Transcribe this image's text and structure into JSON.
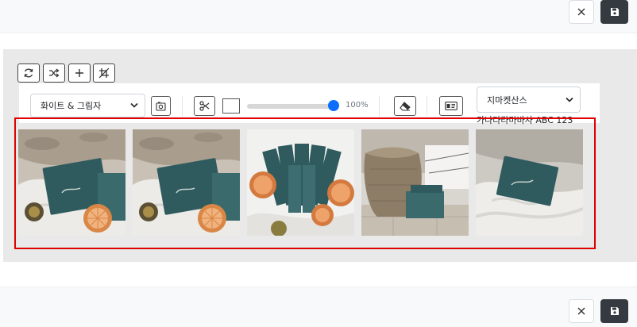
{
  "toolbar": {
    "background_select": {
      "value": "화이트 & 그림자"
    },
    "font_select": {
      "value": "지마켓산스"
    },
    "opacity_slider": {
      "value_label": "100%",
      "value": 1.0
    },
    "font_preview_text": "가나다라마바사 ABC 123"
  },
  "top_tools": [
    "refresh-icon",
    "shuffle-icon",
    "plus-icon",
    "crop-off-icon"
  ],
  "gallery": {
    "highlight_color": "#e00000",
    "images": [
      {
        "name": "product-image-1",
        "scene": "teal package with dried orange slices on white fabric"
      },
      {
        "name": "product-image-2",
        "scene": "teal package with dried orange slices on white fabric"
      },
      {
        "name": "product-image-3",
        "scene": "teal sachets fanned in basket with grapefruit slices"
      },
      {
        "name": "product-image-4",
        "scene": "teal box beside woven basket on tiled floor"
      },
      {
        "name": "product-image-5",
        "scene": "teal box on rumpled white sheets"
      }
    ]
  },
  "colors": {
    "accent": "#0d6efd",
    "save_button": "#343a40",
    "package_teal": "#2f5b5e"
  }
}
